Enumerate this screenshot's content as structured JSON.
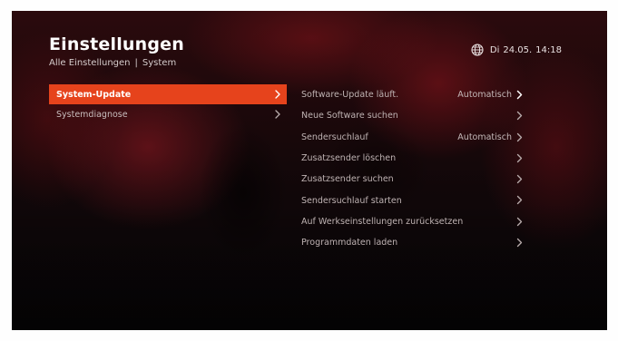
{
  "header": {
    "title": "Einstellungen",
    "breadcrumb_root": "Alle Einstellungen",
    "breadcrumb_sep": "|",
    "breadcrumb_current": "System"
  },
  "status": {
    "globe_icon": "globe-icon",
    "day": "Di",
    "date": "24.05.",
    "time": "14:18"
  },
  "left_menu": {
    "items": [
      {
        "label": "System-Update",
        "active": true
      },
      {
        "label": "Systemdiagnose",
        "active": false
      }
    ]
  },
  "options": {
    "items": [
      {
        "label": "Software-Update läuft.",
        "value": "Automatisch"
      },
      {
        "label": "Neue Software suchen",
        "value": ""
      },
      {
        "label": "Sendersuchlauf",
        "value": "Automatisch"
      },
      {
        "label": "Zusatzsender löschen",
        "value": ""
      },
      {
        "label": "Zusatzsender suchen",
        "value": ""
      },
      {
        "label": "Sendersuchlauf starten",
        "value": ""
      },
      {
        "label": "Auf Werkseinstellungen zurücksetzen",
        "value": ""
      },
      {
        "label": "Programmdaten laden",
        "value": ""
      }
    ]
  },
  "colors": {
    "accent": "#e6431c",
    "text": "#ffffff",
    "muted_text": "#bfb3b3"
  }
}
